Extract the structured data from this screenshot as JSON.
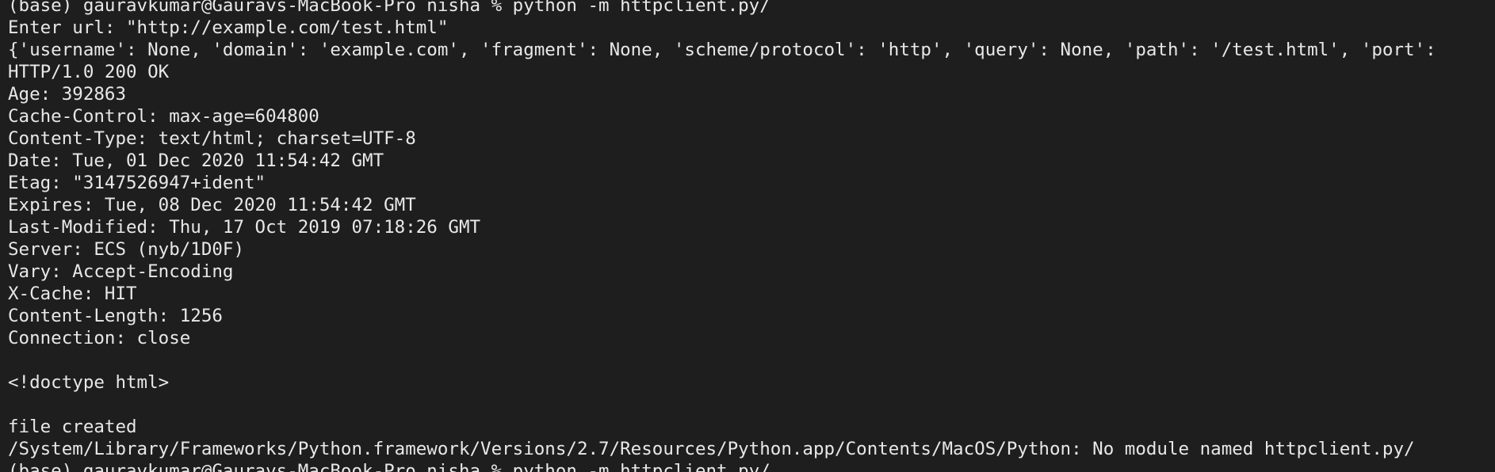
{
  "terminal": {
    "background": "#1e1e1e",
    "text_color": "#e8e8e8",
    "lines": [
      "(base) gauravkumar@Gauravs-MacBook-Pro nisha % python -m httpclient.py/",
      "Enter url: \"http://example.com/test.html\"",
      "{'username': None, 'domain': 'example.com', 'fragment': None, 'scheme/protocol': 'http', 'query': None, 'path': '/test.html', 'port':",
      "HTTP/1.0 200 OK",
      "Age: 392863",
      "Cache-Control: max-age=604800",
      "Content-Type: text/html; charset=UTF-8",
      "Date: Tue, 01 Dec 2020 11:54:42 GMT",
      "Etag: \"3147526947+ident\"",
      "Expires: Tue, 08 Dec 2020 11:54:42 GMT",
      "Last-Modified: Thu, 17 Oct 2019 07:18:26 GMT",
      "Server: ECS (nyb/1D0F)",
      "Vary: Accept-Encoding",
      "X-Cache: HIT",
      "Content-Length: 1256",
      "Connection: close",
      "",
      "<!doctype html>",
      "",
      "file created",
      "/System/Library/Frameworks/Python.framework/Versions/2.7/Resources/Python.app/Contents/MacOS/Python: No module named httpclient.py/",
      "(base) gauravkumar@Gauravs-MacBook-Pro nisha % python -m httpclient.py/"
    ]
  }
}
